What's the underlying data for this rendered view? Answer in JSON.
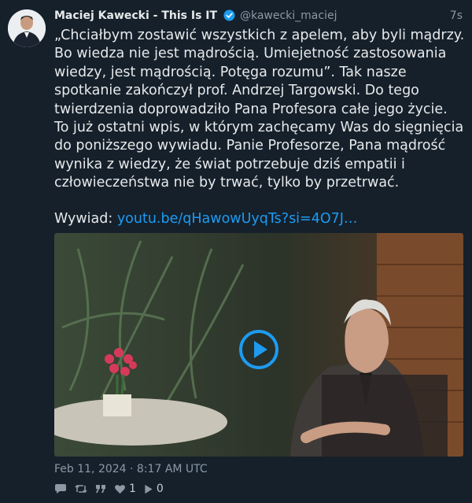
{
  "author": {
    "name": "Maciej Kawecki - This Is IT",
    "handle": "@kawecki_maciej",
    "time_ago": "7s"
  },
  "tweet": {
    "text": "„Chciałbym zostawić wszystkich z apelem, aby byli mądrzy. Bo wiedza nie jest mądrością. Umiejetność zastosowania wiedzy, jest mądrością. Potęga rozumu”. Tak nasze spotkanie zakończył prof. Andrzej Targowski. Do tego twierdzenia doprowadziło Pana Profesora całe jego życie. To już ostatni wpis, w którym zachęcamy Was do sięgnięcia do poniższego wywiadu. Panie Profesorze, Pana mądrość wynika z wiedzy, że świat potrzebuje dziś empatii i człowieczeństwa nie by trwać, tylko by przetrwać.",
    "link_prefix": "Wywiad: ",
    "link_text": "youtu.be/qHawowUyqTs?si=4O7J…"
  },
  "timestamp": "Feb 11, 2024 · 8:17 AM UTC",
  "actions": {
    "reply_icon": "reply-icon",
    "retweet_icon": "retweet-icon",
    "quote_icon": "quote-icon",
    "like_icon": "heart-icon",
    "like_count": "1",
    "play_icon": "play-icon",
    "play_count": "0"
  },
  "colors": {
    "background": "#15202b",
    "link": "#1d9bf0",
    "muted": "#8b98a5",
    "verified": "#1d9bf0"
  }
}
